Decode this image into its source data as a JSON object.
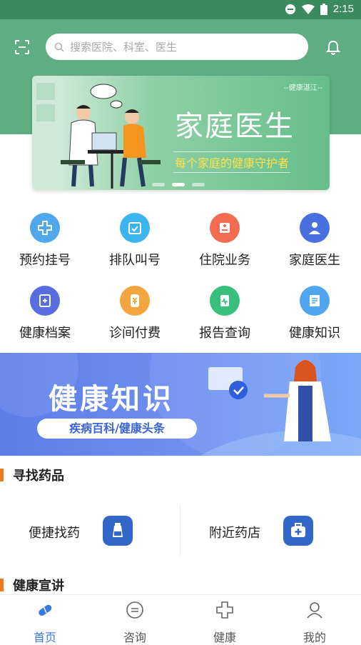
{
  "status": {
    "time": "2:15"
  },
  "header": {
    "search_placeholder": "搜索医院、科室、医生"
  },
  "banner": {
    "brand": "--健康湛江--",
    "title": "家庭医生",
    "subtitle": "每个家庭的健康守护者",
    "page_count": 3,
    "active_page": 2
  },
  "grid": [
    {
      "label": "预约挂号",
      "icon": "plus-cross-icon",
      "color": "#4fa7ec"
    },
    {
      "label": "排队叫号",
      "icon": "calendar-check-icon",
      "color": "#3cb4ee"
    },
    {
      "label": "住院业务",
      "icon": "hospital-bed-icon",
      "color": "#f36c52"
    },
    {
      "label": "家庭医生",
      "icon": "doctor-icon",
      "color": "#4a6fe0"
    },
    {
      "label": "健康档案",
      "icon": "health-record-icon",
      "color": "#5a6de0"
    },
    {
      "label": "诊间付费",
      "icon": "payment-icon",
      "color": "#f3a640"
    },
    {
      "label": "报告查询",
      "icon": "report-icon",
      "color": "#36c07c"
    },
    {
      "label": "健康知识",
      "icon": "book-icon",
      "color": "#4fa6ee"
    }
  ],
  "knowledge_banner": {
    "title": "健康知识",
    "subtitle": "疾病百科/健康头条"
  },
  "sections": {
    "find_drugs": "寻找药品",
    "health_talks": "健康宣讲"
  },
  "drugs": [
    {
      "label": "便捷找药",
      "icon": "medicine-bottle-icon"
    },
    {
      "label": "附近药店",
      "icon": "medicine-kit-icon"
    }
  ],
  "tabs": [
    {
      "label": "首页",
      "icon": "home-pill-icon",
      "active": true
    },
    {
      "label": "咨询",
      "icon": "chat-icon",
      "active": false
    },
    {
      "label": "健康",
      "icon": "health-cross-icon",
      "active": false
    },
    {
      "label": "我的",
      "icon": "user-icon",
      "active": false
    }
  ]
}
